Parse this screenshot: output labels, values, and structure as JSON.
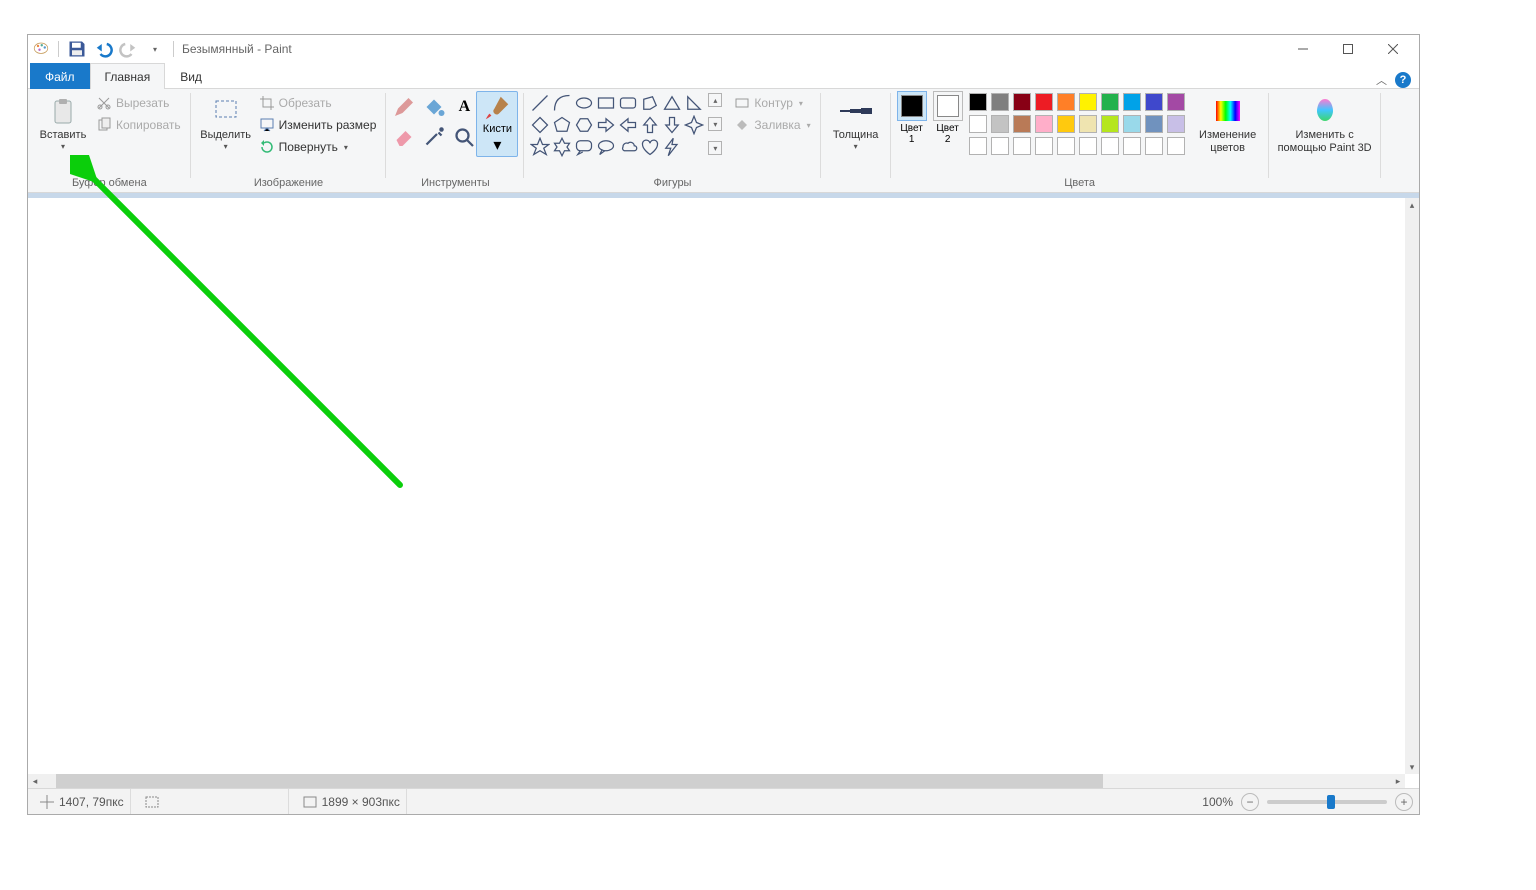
{
  "title": "Безымянный - Paint",
  "tabs": {
    "file": "Файл",
    "home": "Главная",
    "view": "Вид"
  },
  "groups": {
    "clipboard": {
      "paste": "Вставить",
      "cut": "Вырезать",
      "copy": "Копировать",
      "label": "Буфер обмена"
    },
    "image": {
      "select": "Выделить",
      "crop": "Обрезать",
      "resize": "Изменить размер",
      "rotate": "Повернуть",
      "label": "Изображение"
    },
    "tools": {
      "label": "Инструменты",
      "brushes": "Кисти"
    },
    "shapes": {
      "label": "Фигуры",
      "outline": "Контур",
      "fill": "Заливка"
    },
    "size": {
      "label": "Толщина"
    },
    "colors": {
      "c1": "Цвет\n1",
      "c2": "Цвет\n2",
      "label": "Цвета",
      "edit": "Изменение\nцветов"
    },
    "paint3d": {
      "label": "Изменить с\nпомощью Paint 3D"
    }
  },
  "palette_row1": [
    "#000000",
    "#7f7f7f",
    "#880015",
    "#ed1c24",
    "#ff7f27",
    "#fff200",
    "#22b14c",
    "#00a2e8",
    "#3f48cc",
    "#a349a4"
  ],
  "palette_row2": [
    "#ffffff",
    "#c3c3c3",
    "#b97a57",
    "#ffaec9",
    "#ffc90e",
    "#efe4b0",
    "#b5e61d",
    "#99d9ea",
    "#7092be",
    "#c8bfe7"
  ],
  "palette_row3": [
    "#ffffff",
    "#ffffff",
    "#ffffff",
    "#ffffff",
    "#ffffff",
    "#ffffff",
    "#ffffff",
    "#ffffff",
    "#ffffff",
    "#ffffff"
  ],
  "color1": "#000000",
  "color2": "#ffffff",
  "status": {
    "coords": "1407, 79пкс",
    "dims": "1899 × 903пкс",
    "zoom": "100%"
  },
  "hscroll_thumb_pct": 76
}
